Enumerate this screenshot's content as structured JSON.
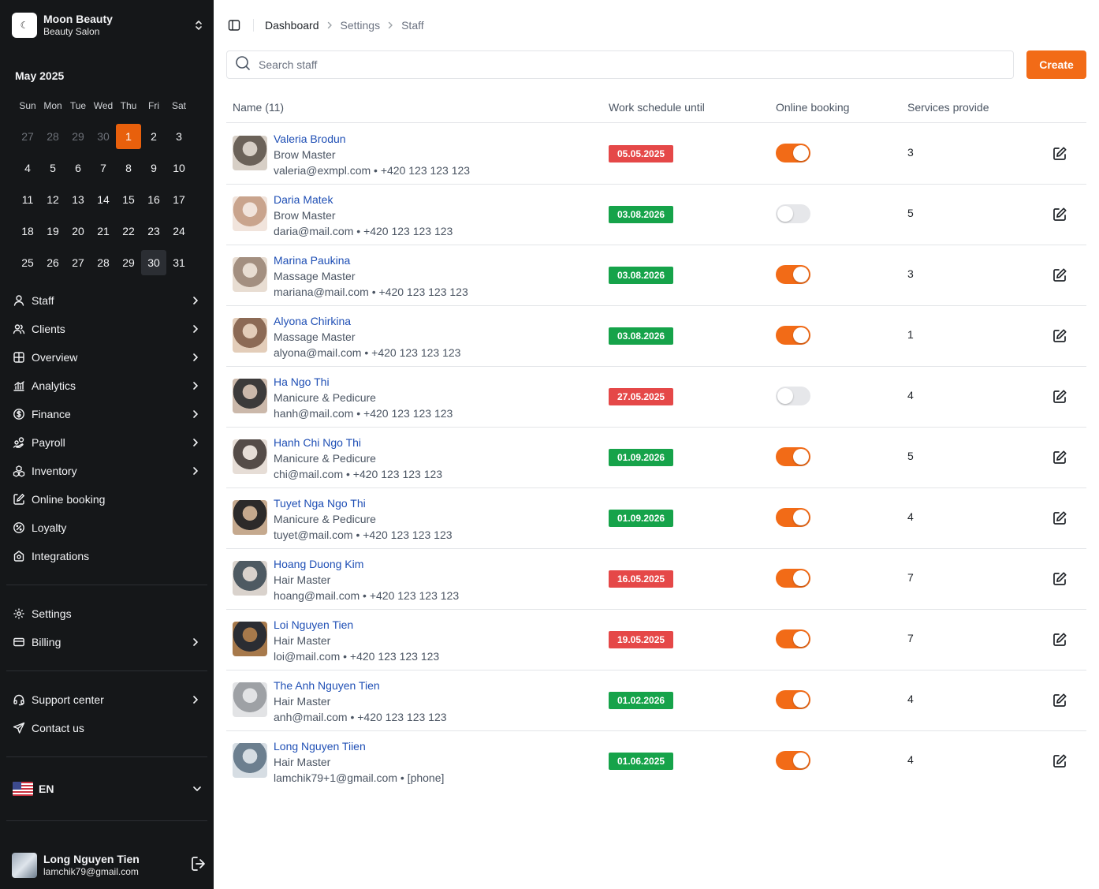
{
  "brand": {
    "name": "Moon Beauty",
    "subtitle": "Beauty Salon"
  },
  "calendar": {
    "month_label": "May 2025",
    "weekdays": [
      "Sun",
      "Mon",
      "Tue",
      "Wed",
      "Thu",
      "Fri",
      "Sat"
    ],
    "weeks": [
      [
        "27",
        "28",
        "29",
        "30",
        "1",
        "2",
        "3"
      ],
      [
        "4",
        "5",
        "6",
        "7",
        "8",
        "9",
        "10"
      ],
      [
        "11",
        "12",
        "13",
        "14",
        "15",
        "16",
        "17"
      ],
      [
        "18",
        "19",
        "20",
        "21",
        "22",
        "23",
        "24"
      ],
      [
        "25",
        "26",
        "27",
        "28",
        "29",
        "30",
        "31"
      ]
    ],
    "selected_day": "1",
    "today_day": "30"
  },
  "nav": {
    "items": [
      {
        "label": "Staff",
        "icon": "user-icon"
      },
      {
        "label": "Clients",
        "icon": "users-icon"
      },
      {
        "label": "Overview",
        "icon": "layout-icon"
      },
      {
        "label": "Analytics",
        "icon": "bar-chart-icon"
      },
      {
        "label": "Finance",
        "icon": "dollar-icon"
      },
      {
        "label": "Payroll",
        "icon": "hand-coins-icon"
      },
      {
        "label": "Inventory",
        "icon": "boxes-icon"
      },
      {
        "label": "Online booking",
        "icon": "booking-icon"
      },
      {
        "label": "Loyalty",
        "icon": "badge-percent-icon"
      },
      {
        "label": "Integrations",
        "icon": "puzzle-icon"
      }
    ],
    "settings": {
      "label": "Settings",
      "icon": "gear-icon"
    },
    "billing": {
      "label": "Billing",
      "icon": "card-icon"
    },
    "support": {
      "label": "Support center",
      "icon": "headset-icon"
    },
    "contact": {
      "label": "Contact us",
      "icon": "send-icon"
    }
  },
  "language": {
    "label": "EN",
    "flag": "us-flag-icon"
  },
  "user": {
    "name": "Long Nguyen Tien",
    "email": "lamchik79@gmail.com"
  },
  "breadcrumb": [
    "Dashboard",
    "Settings",
    "Staff"
  ],
  "search": {
    "placeholder": "Search staff",
    "value": ""
  },
  "create_label": "Create",
  "table": {
    "headers": {
      "name": "Name (11)",
      "schedule": "Work schedule until",
      "online": "Online booking",
      "services": "Services provide"
    },
    "rows": [
      {
        "name": "Valeria Brodun",
        "role": "Brow Master",
        "contact": "valeria@exmpl.com • +420 123 123 123",
        "date": "05.05.2025",
        "status": "red",
        "online": true,
        "services": "3"
      },
      {
        "name": "Daria Matek",
        "role": "Brow Master",
        "contact": "daria@mail.com • +420 123 123 123",
        "date": "03.08.2026",
        "status": "green",
        "online": false,
        "services": "5"
      },
      {
        "name": "Marina Paukina",
        "role": "Massage Master",
        "contact": "mariana@mail.com • +420 123 123 123",
        "date": "03.08.2026",
        "status": "green",
        "online": true,
        "services": "3"
      },
      {
        "name": "Alyona Chirkina",
        "role": "Massage Master",
        "contact": "alyona@mail.com • +420 123 123 123",
        "date": "03.08.2026",
        "status": "green",
        "online": true,
        "services": "1"
      },
      {
        "name": "Ha Ngo Thi",
        "role": "Manicure & Pedicure",
        "contact": "hanh@mail.com • +420 123 123 123",
        "date": "27.05.2025",
        "status": "red",
        "online": false,
        "services": "4"
      },
      {
        "name": "Hanh Chi Ngo Thi",
        "role": "Manicure & Pedicure",
        "contact": "chi@mail.com • +420 123 123 123",
        "date": "01.09.2026",
        "status": "green",
        "online": true,
        "services": "5"
      },
      {
        "name": "Tuyet Nga Ngo Thi",
        "role": "Manicure & Pedicure",
        "contact": "tuyet@mail.com • +420 123 123 123",
        "date": "01.09.2026",
        "status": "green",
        "online": true,
        "services": "4"
      },
      {
        "name": "Hoang Duong Kim",
        "role": "Hair Master",
        "contact": "hoang@mail.com • +420 123 123 123",
        "date": "16.05.2025",
        "status": "red",
        "online": true,
        "services": "7"
      },
      {
        "name": "Loi Nguyen Tien",
        "role": "Hair Master",
        "contact": "loi@mail.com • +420 123 123 123",
        "date": "19.05.2025",
        "status": "red",
        "online": true,
        "services": "7"
      },
      {
        "name": "The Anh Nguyen Tien",
        "role": "Hair Master",
        "contact": "anh@mail.com • +420 123 123 123",
        "date": "01.02.2026",
        "status": "green",
        "online": true,
        "services": "4"
      },
      {
        "name": "Long Nguyen Tiien",
        "role": "Hair Master",
        "contact": "lamchik79+1@gmail.com • [phone]",
        "date": "01.06.2025",
        "status": "green",
        "online": true,
        "services": "4"
      }
    ]
  },
  "colors": {
    "accent": "#f26b17",
    "sidebar_bg": "#151719",
    "badge_red": "#e54848",
    "badge_green": "#16a34a",
    "link": "#1f4fb5"
  }
}
